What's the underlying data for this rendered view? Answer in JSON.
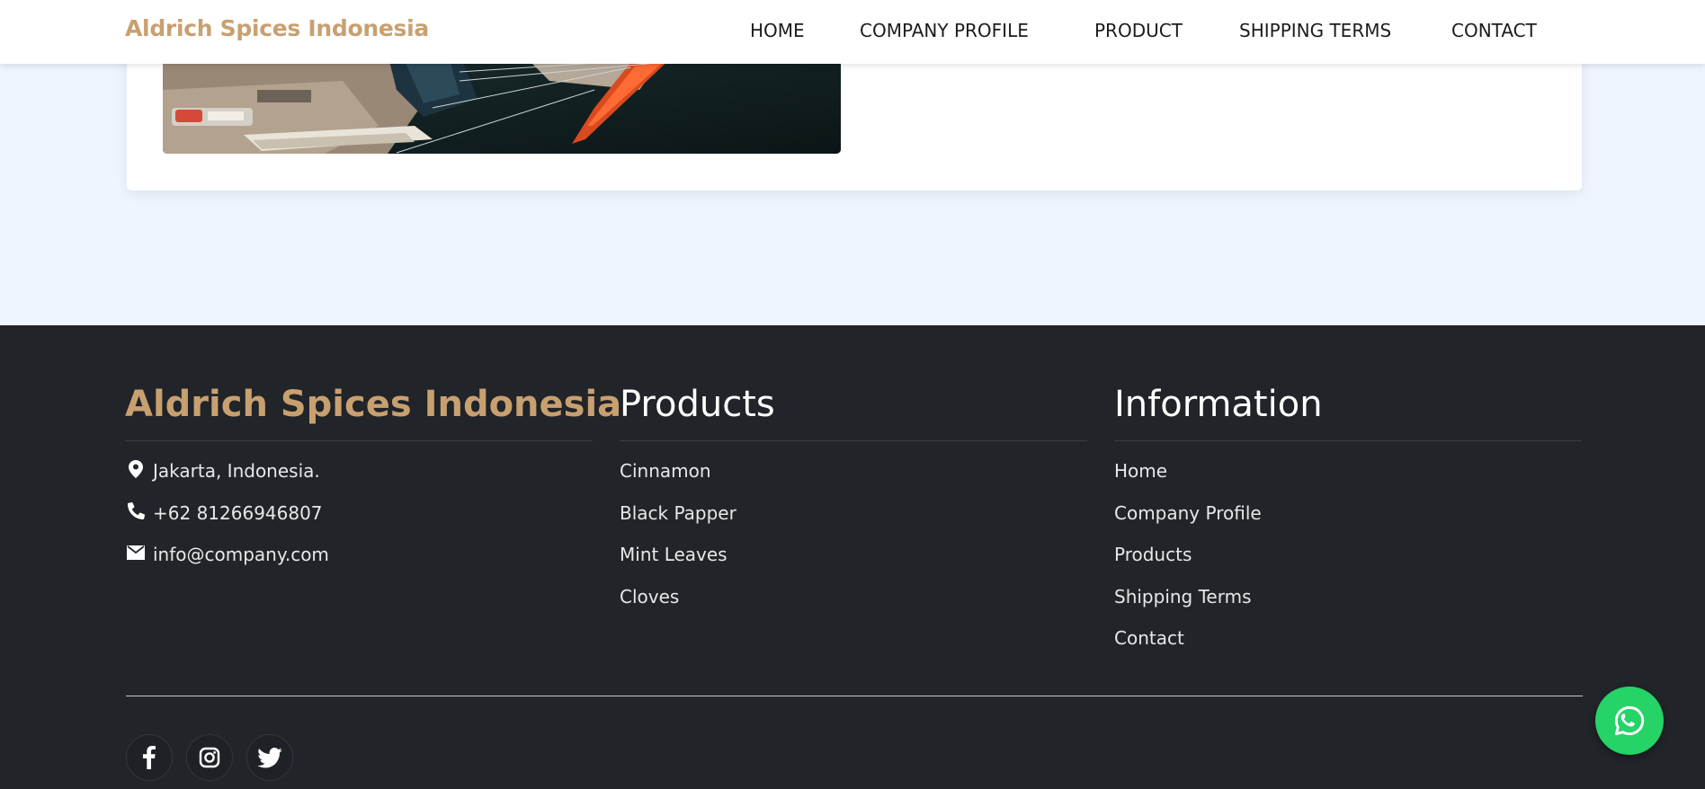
{
  "navbar": {
    "brand": "Aldrich Spices Indonesia",
    "links": [
      "HOME",
      "COMPANY PROFILE",
      "PRODUCT",
      "SHIPPING TERMS",
      "CONTACT"
    ]
  },
  "footer": {
    "company": {
      "title": "Aldrich Spices Indonesia",
      "address": "Jakarta, Indonesia.",
      "phone": "+62 81266946807",
      "email": "info@company.com"
    },
    "products": {
      "title": "Products",
      "items": [
        "Cinnamon",
        "Black Papper",
        "Mint Leaves",
        "Cloves"
      ]
    },
    "information": {
      "title": "Information",
      "items": [
        "Home",
        "Company Profile",
        "Products",
        "Shipping Terms",
        "Contact"
      ]
    },
    "socials": [
      "facebook-icon",
      "instagram-icon",
      "twitter-icon"
    ]
  },
  "whatsapp": {
    "icon": "whatsapp-icon"
  },
  "colors": {
    "brand_gold": "#c8a070",
    "footer_bg": "#212429",
    "page_bg": "#eef5ff",
    "whatsapp_green": "#25d366"
  }
}
